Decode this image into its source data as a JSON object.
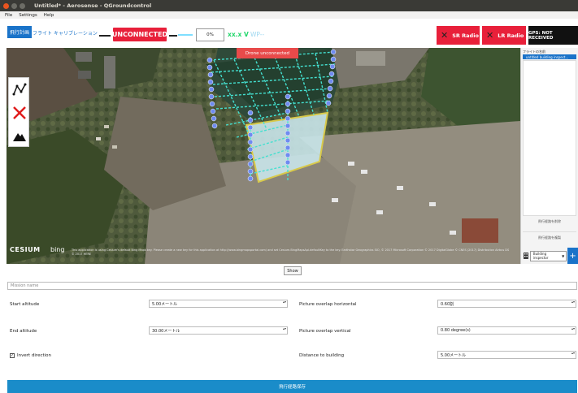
{
  "window": {
    "title": "Untitled* - Aerosense - QGroundcontrol"
  },
  "menu": {
    "file": "File",
    "settings": "Settings",
    "help": "Help"
  },
  "toolbar": {
    "plan_tab": "飛行計画",
    "fly_tab": "フライト",
    "calibration_tab": "キャリブレーション",
    "connection_status": "UNCONNECTED",
    "battery_percent": "0%",
    "voltage": "xx.x V",
    "waypoint": "WP--",
    "sr_radio": "SR Radio",
    "lr_radio": "LR Radio",
    "gps_status": "GPS: NOT RECEIVED"
  },
  "map": {
    "tooltip": "Drone unconnected",
    "cesium_label": "CESIUM",
    "bing_label": "bing",
    "attribution": "This application is using Cesium's default Bing Maps key. Please create a new key for this application at http://www.bingmapsportal.com/ and set Cesium.BingMapsApi.defaultKey to the key. Earthstar Geographics SIO, © 2017 Microsoft Corporation © 2017 DigitalGlobe © CNES (2017) Distribution Airbus DS © 2017 HERE"
  },
  "sidebar": {
    "header": "フライトの名前",
    "selected_flight": "untitled building inspect...",
    "button_delete": "飛行経路を削除",
    "button_copy": "飛行経路を複製",
    "mission_type": "Building inspector",
    "add_label": "+"
  },
  "form": {
    "show_button": "Show",
    "mission_name_placeholder": "Mission name",
    "start_altitude_label": "Start altitude",
    "start_altitude_value": "5.00メートル",
    "end_altitude_label": "End altitude",
    "end_altitude_value": "30.00メートル",
    "invert_direction_label": "Invert direction",
    "invert_checked_mark": "✓",
    "overlap_h_label": "Picture overlap horizontal",
    "overlap_h_value": "0.60割",
    "overlap_v_label": "Picture overlap vertical",
    "overlap_v_value": "0.80 degree(s)",
    "distance_label": "Distance to building",
    "distance_value": "5.00メートル",
    "spin_arrows": "▴▾",
    "save_button": "飛行経路保存"
  },
  "colors": {
    "accent_blue": "#1a73c9",
    "alert_red": "#e8203a",
    "voltage_green": "#22d66b",
    "path_cyan": "#44e0d0"
  }
}
